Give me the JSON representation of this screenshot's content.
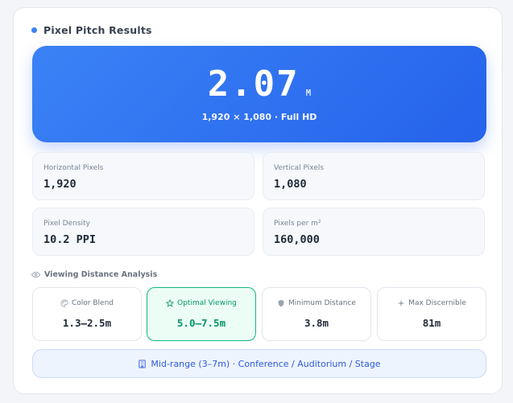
{
  "header": {
    "title": "Pixel Pitch Results"
  },
  "hero": {
    "value": "2.07",
    "unit": "M",
    "subtitle": "1,920 × 1,080 · Full HD"
  },
  "stats": [
    {
      "label": "Horizontal Pixels",
      "value": "1,920"
    },
    {
      "label": "Vertical Pixels",
      "value": "1,080"
    },
    {
      "label": "Pixel Density",
      "value": "10.2 PPI"
    },
    {
      "label": "Pixels per m²",
      "value": "160,000"
    }
  ],
  "viewing": {
    "section_label": "Viewing Distance Analysis",
    "cards": [
      {
        "label": "Color Blend",
        "value": "1.3–2.5m",
        "icon": "palette-icon"
      },
      {
        "label": "Optimal Viewing",
        "value": "5.0–7.5m",
        "icon": "star-icon"
      },
      {
        "label": "Minimum Distance",
        "value": "3.8m",
        "icon": "shield-icon"
      },
      {
        "label": "Max Discernible",
        "value": "81m",
        "icon": "sparkle-icon"
      }
    ]
  },
  "recommendation": {
    "text": "Mid-range (3–7m) · Conference / Auditorium / Stage",
    "icon": "building-icon"
  },
  "colors": {
    "accent": "#2563eb",
    "optimal": "#10b981"
  }
}
